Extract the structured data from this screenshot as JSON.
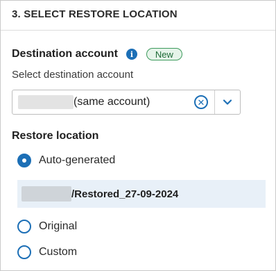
{
  "section": {
    "title": "3. SELECT RESTORE LOCATION"
  },
  "destination": {
    "label": "Destination account",
    "info_icon": "i",
    "badge": "New",
    "sublabel": "Select destination account",
    "selected_value": "(same account)",
    "clear_icon": "✕"
  },
  "restore": {
    "label": "Restore location",
    "options": [
      {
        "label": "Auto-generated",
        "checked": true
      },
      {
        "label": "Original",
        "checked": false
      },
      {
        "label": "Custom",
        "checked": false
      }
    ],
    "auto_path": "/Restored_27-09-2024"
  },
  "colors": {
    "accent": "#1c6fb6",
    "badge_bg": "#e6f4ea",
    "badge_border": "#3d9a5c",
    "path_bg": "#e8f0f8"
  }
}
